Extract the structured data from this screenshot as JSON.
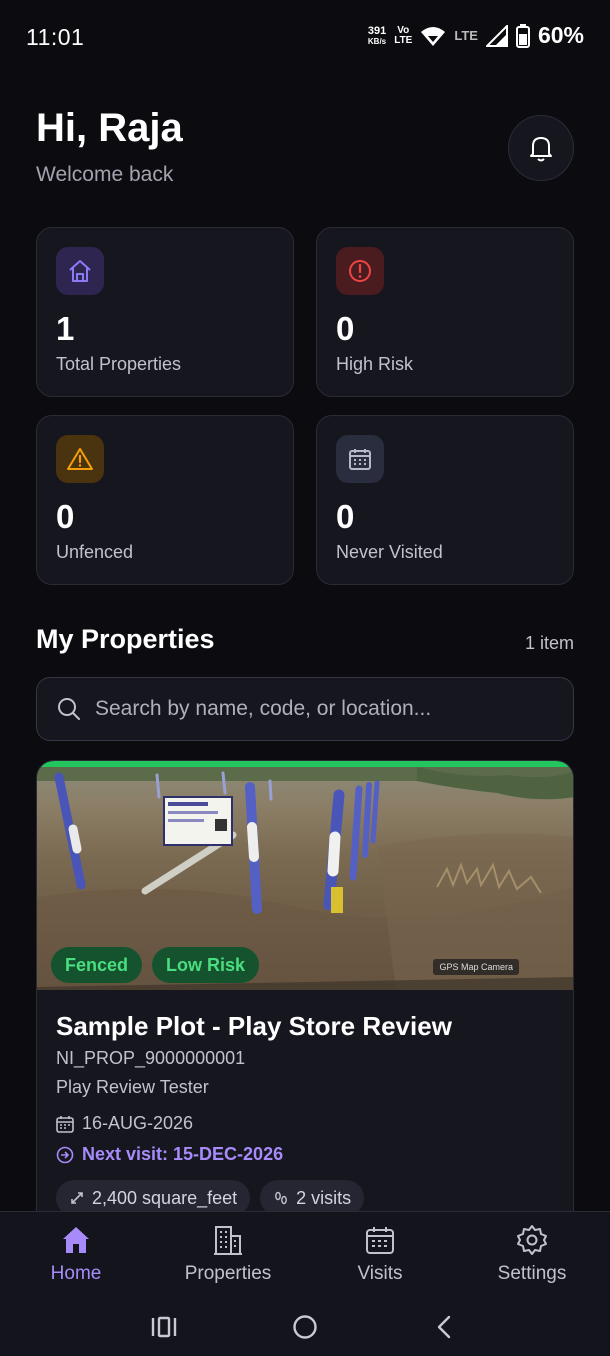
{
  "status_bar": {
    "time": "11:01",
    "net_speed": "391",
    "net_speed_unit": "KB/s",
    "volte_top": "Vo",
    "volte_bottom": "LTE",
    "lte": "LTE",
    "battery": "60%"
  },
  "header": {
    "greeting": "Hi, Raja",
    "subtitle": "Welcome back",
    "bell_icon": "bell-icon"
  },
  "stats": [
    {
      "value": "1",
      "label": "Total Properties",
      "icon": "home-icon",
      "color": "#7c6cf0"
    },
    {
      "value": "0",
      "label": "High Risk",
      "icon": "alert-circle-icon",
      "color": "#ef4444"
    },
    {
      "value": "0",
      "label": "Unfenced",
      "icon": "warning-triangle-icon",
      "color": "#f59e0b"
    },
    {
      "value": "0",
      "label": "Never Visited",
      "icon": "calendar-icon",
      "color": "#9aa0b4"
    }
  ],
  "properties_section": {
    "title": "My Properties",
    "count": "1 item",
    "search_placeholder": "Search by name, code, or location..."
  },
  "property": {
    "badges": [
      "Fenced",
      "Low Risk"
    ],
    "photo_tag": "GPS Map Camera",
    "title": "Sample Plot - Play Store Review",
    "code": "NI_PROP_9000000001",
    "owner": "Play Review Tester",
    "date": "16-AUG-2026",
    "next_visit": "Next visit: 15-DEC-2026",
    "area": "2,400 square_feet",
    "visits": "2 visits",
    "accent": "#22c55e"
  },
  "nav": {
    "items": [
      {
        "label": "Home",
        "active": true
      },
      {
        "label": "Properties",
        "active": false
      },
      {
        "label": "Visits",
        "active": false
      },
      {
        "label": "Settings",
        "active": false
      }
    ],
    "active_color": "#a78bfa"
  }
}
